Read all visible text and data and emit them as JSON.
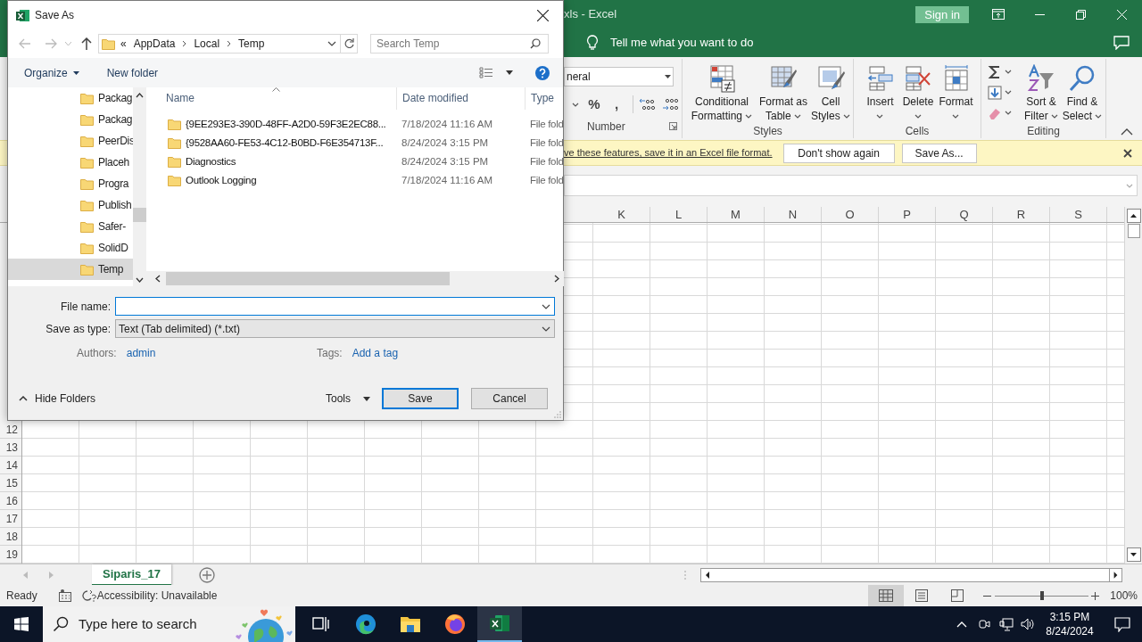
{
  "excel": {
    "title": "xls - Excel",
    "sign_in": "Sign in",
    "tell_me": "Tell me what you want to do",
    "number_group": {
      "format": "neral",
      "buttons": [
        "%",
        ","
      ],
      "label": "Number"
    },
    "groups": [
      {
        "label": "Styles",
        "buttons": [
          {
            "kind": "conditional",
            "label": "Conditional Formatting"
          },
          {
            "kind": "table",
            "label": "Format as Table"
          },
          {
            "kind": "cellstyles",
            "label": "Cell Styles"
          }
        ]
      },
      {
        "label": "Cells",
        "buttons": [
          {
            "kind": "insert",
            "label": "Insert"
          },
          {
            "kind": "delete",
            "label": "Delete"
          },
          {
            "kind": "format",
            "label": "Format"
          }
        ]
      },
      {
        "label": "Editing",
        "buttons": [
          {
            "kind": "sort",
            "label": "Sort & Filter"
          },
          {
            "kind": "find",
            "label": "Find & Select"
          }
        ]
      }
    ],
    "message_bar": {
      "text": "ve these features, save it in an Excel file format.",
      "buttons": [
        "Don't show again",
        "Save As..."
      ]
    },
    "columns": [
      "K",
      "L",
      "M",
      "N",
      "O",
      "P",
      "Q",
      "R",
      "S"
    ],
    "rows": [
      "12",
      "13",
      "14",
      "15",
      "16",
      "17",
      "18",
      "19"
    ],
    "sheet_tabs": [
      {
        "label": "Siparis_17",
        "selected": true
      }
    ],
    "status_bar": {
      "state": "Ready",
      "accessibility": "Accessibility: Unavailable",
      "views": [
        {
          "kind": "normal",
          "selected": true
        },
        {
          "kind": "page_layout",
          "selected": false
        },
        {
          "kind": "page_break",
          "selected": false
        }
      ],
      "zoom": {
        "level": 0.5,
        "reading": "100%"
      }
    }
  },
  "dialog": {
    "title": "Save As",
    "address": {
      "overflow": "«",
      "path": [
        "AppData",
        "Local",
        "Temp"
      ]
    },
    "search": {
      "placeholder": "Search Temp"
    },
    "toolbar": {
      "organize": "Organize",
      "new_folder": "New folder"
    },
    "nav_items": [
      {
        "label": "Packag",
        "selected": false
      },
      {
        "label": "Packag",
        "selected": false
      },
      {
        "label": "PeerDis",
        "selected": false
      },
      {
        "label": "Placeh",
        "selected": false
      },
      {
        "label": "Progra",
        "selected": false
      },
      {
        "label": "Publish",
        "selected": false
      },
      {
        "label": "Safer-",
        "selected": false
      },
      {
        "label": "SolidD",
        "selected": false
      },
      {
        "label": "Temp",
        "selected": true
      }
    ],
    "columns": [
      "Name",
      "Date modified",
      "Type"
    ],
    "files": [
      {
        "name": "{9EE293E3-390D-48FF-A2D0-59F3E2EC88...",
        "date": "7/18/2024 11:16 AM",
        "type": "File fold"
      },
      {
        "name": "{9528AA60-FE53-4C12-B0BD-F6E354713F...",
        "date": "8/24/2024 3:15 PM",
        "type": "File fold"
      },
      {
        "name": "Diagnostics",
        "date": "8/24/2024 3:15 PM",
        "type": "File fold"
      },
      {
        "name": "Outlook Logging",
        "date": "7/18/2024 11:16 AM",
        "type": "File fold"
      }
    ],
    "file_name": {
      "label": "File name:"
    },
    "save_as_type": {
      "label": "Save as type:",
      "value": "Text (Tab delimited) (*.txt)"
    },
    "authors": {
      "label": "Authors:",
      "value": "admin"
    },
    "tags": {
      "label": "Tags:",
      "value": "Add a tag"
    },
    "hide_folders": "Hide Folders",
    "tools": "Tools",
    "buttons": [
      {
        "label": "Save",
        "default": true
      },
      {
        "label": "Cancel",
        "default": false
      }
    ]
  },
  "taskbar": {
    "search_placeholder": "Type here to search",
    "apps": [
      {
        "kind": "task_view",
        "selected": false
      },
      {
        "kind": "edge",
        "selected": false
      },
      {
        "kind": "explorer",
        "selected": false
      },
      {
        "kind": "firefox",
        "selected": false
      },
      {
        "kind": "excel",
        "selected": true
      }
    ],
    "time": "3:15 PM",
    "date": "8/24/2024"
  }
}
